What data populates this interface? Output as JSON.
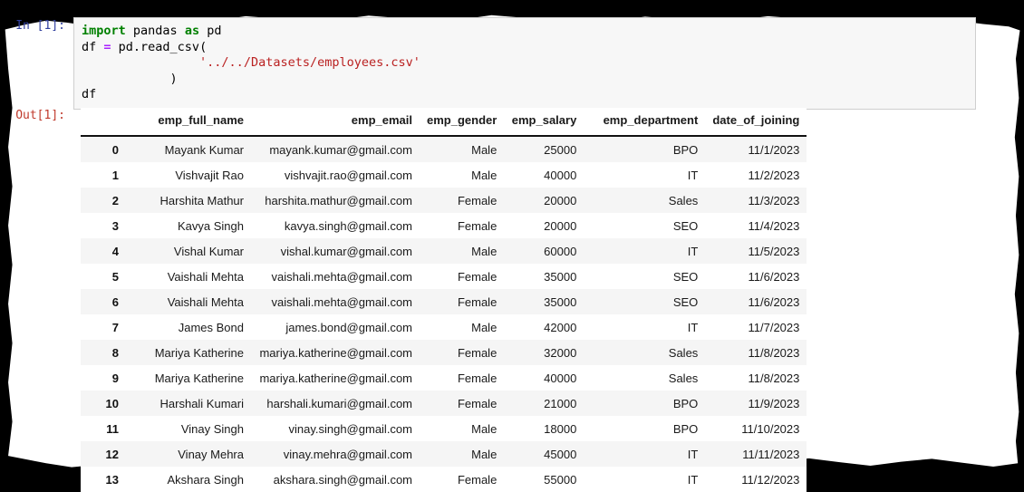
{
  "notebook": {
    "input_prompt": "In [1]:",
    "output_prompt": "Out[1]:",
    "code": {
      "line1_kw_import": "import",
      "line1_module": " pandas ",
      "line1_kw_as": "as",
      "line1_alias": " pd",
      "line2_var": "df ",
      "line2_op": "=",
      "line2_call": " pd.read_csv(",
      "line3_indent": "                ",
      "line3_str": "'../../Datasets/employees.csv'",
      "line4_close": "            )",
      "line5_var": "df"
    }
  },
  "dataframe": {
    "index_header": "",
    "columns": [
      "emp_full_name",
      "emp_email",
      "emp_gender",
      "emp_salary",
      "emp_department",
      "date_of_joining"
    ],
    "index": [
      "0",
      "1",
      "2",
      "3",
      "4",
      "5",
      "6",
      "7",
      "8",
      "9",
      "10",
      "11",
      "12",
      "13"
    ],
    "rows": [
      [
        "Mayank Kumar",
        "mayank.kumar@gmail.com",
        "Male",
        "25000",
        "BPO",
        "11/1/2023"
      ],
      [
        "Vishvajit Rao",
        "vishvajit.rao@gmail.com",
        "Male",
        "40000",
        "IT",
        "11/2/2023"
      ],
      [
        "Harshita Mathur",
        "harshita.mathur@gmail.com",
        "Female",
        "20000",
        "Sales",
        "11/3/2023"
      ],
      [
        "Kavya Singh",
        "kavya.singh@gmail.com",
        "Female",
        "20000",
        "SEO",
        "11/4/2023"
      ],
      [
        "Vishal Kumar",
        "vishal.kumar@gmail.com",
        "Male",
        "60000",
        "IT",
        "11/5/2023"
      ],
      [
        "Vaishali Mehta",
        "vaishali.mehta@gmail.com",
        "Female",
        "35000",
        "SEO",
        "11/6/2023"
      ],
      [
        "Vaishali Mehta",
        "vaishali.mehta@gmail.com",
        "Female",
        "35000",
        "SEO",
        "11/6/2023"
      ],
      [
        "James Bond",
        "james.bond@gmail.com",
        "Male",
        "42000",
        "IT",
        "11/7/2023"
      ],
      [
        "Mariya Katherine",
        "mariya.katherine@gmail.com",
        "Female",
        "32000",
        "Sales",
        "11/8/2023"
      ],
      [
        "Mariya Katherine",
        "mariya.katherine@gmail.com",
        "Female",
        "40000",
        "Sales",
        "11/8/2023"
      ],
      [
        "Harshali Kumari",
        "harshali.kumari@gmail.com",
        "Female",
        "21000",
        "BPO",
        "11/9/2023"
      ],
      [
        "Vinay Singh",
        "vinay.singh@gmail.com",
        "Male",
        "18000",
        "BPO",
        "11/10/2023"
      ],
      [
        "Vinay Mehra",
        "vinay.mehra@gmail.com",
        "Male",
        "45000",
        "IT",
        "11/11/2023"
      ],
      [
        "Akshara Singh",
        "akshara.singh@gmail.com",
        "Female",
        "55000",
        "IT",
        "11/12/2023"
      ]
    ]
  },
  "colors": {
    "input_prompt": "#303F9F",
    "output_prompt": "#C0392B",
    "keyword": "#008000",
    "operator": "#AA22FF",
    "string": "#BA2121",
    "code_background": "#f7f7f7",
    "row_stripe": "#f5f5f5",
    "frame": "#000000"
  }
}
